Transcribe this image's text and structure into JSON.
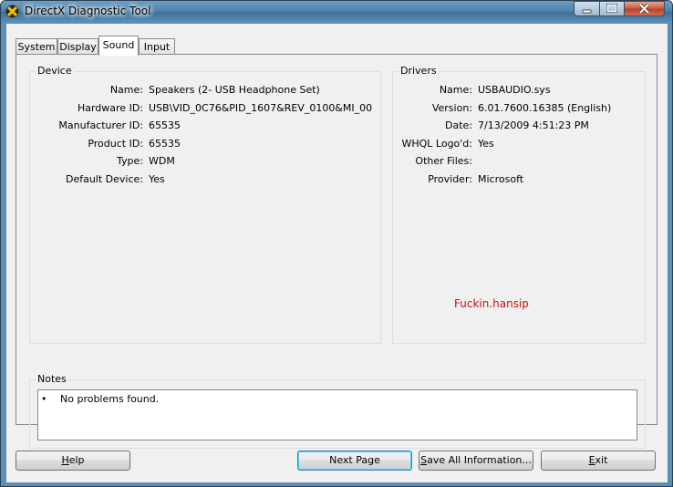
{
  "window": {
    "title": "DirectX Diagnostic Tool"
  },
  "tabs": [
    {
      "label": "System"
    },
    {
      "label": "Display"
    },
    {
      "label": "Sound"
    },
    {
      "label": "Input"
    }
  ],
  "device": {
    "heading": "Device",
    "rows": [
      {
        "label": "Name:",
        "value": "Speakers (2- USB Headphone Set)"
      },
      {
        "label": "Hardware ID:",
        "value": "USB\\VID_0C76&PID_1607&REV_0100&MI_00"
      },
      {
        "label": "Manufacturer ID:",
        "value": "65535"
      },
      {
        "label": "Product ID:",
        "value": "65535"
      },
      {
        "label": "Type:",
        "value": "WDM"
      },
      {
        "label": "Default Device:",
        "value": "Yes"
      }
    ]
  },
  "drivers": {
    "heading": "Drivers",
    "rows": [
      {
        "label": "Name:",
        "value": "USBAUDIO.sys"
      },
      {
        "label": "Version:",
        "value": "6.01.7600.16385 (English)"
      },
      {
        "label": "Date:",
        "value": "7/13/2009 4:51:23 PM"
      },
      {
        "label": "WHQL Logo'd:",
        "value": "Yes"
      },
      {
        "label": "Other Files:",
        "value": ""
      },
      {
        "label": "Provider:",
        "value": "Microsoft"
      }
    ]
  },
  "watermark": "Fuckin.hansip",
  "notes": {
    "heading": "Notes",
    "bullet": "•",
    "text": "No problems found."
  },
  "buttons": {
    "help": {
      "first": "H",
      "rest": "elp"
    },
    "next": "Next Page",
    "save": {
      "first": "S",
      "rest": "ave All Information..."
    },
    "exit": {
      "first": "E",
      "rest": "xit"
    }
  },
  "colors": {
    "watermark": "#cc1010",
    "frame": "#5d8fb5",
    "close": "#c75a3e"
  }
}
